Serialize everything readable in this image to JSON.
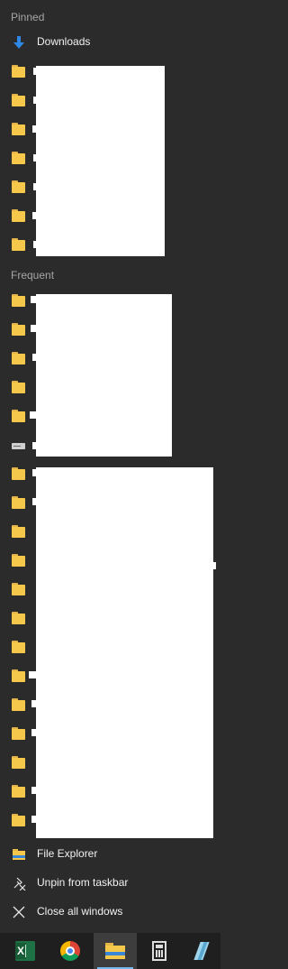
{
  "jumplist": {
    "pinned_header": "Pinned",
    "downloads_label": "Downloads",
    "frequent_header": "Frequent",
    "actions": [
      {
        "label": "File Explorer",
        "icon": "file-explorer-icon"
      },
      {
        "label": "Unpin from taskbar",
        "icon": "unpin-icon"
      },
      {
        "label": "Close all windows",
        "icon": "close-icon"
      }
    ]
  },
  "taskbar": {
    "apps": [
      {
        "name": "excel",
        "icon": "excel-icon",
        "active": false
      },
      {
        "name": "chrome",
        "icon": "chrome-icon",
        "active": false
      },
      {
        "name": "file-explorer",
        "icon": "file-explorer-icon",
        "active": true
      },
      {
        "name": "calculator",
        "icon": "calculator-icon",
        "active": false
      },
      {
        "name": "pen",
        "icon": "pen-icon",
        "active": false
      }
    ],
    "active_indicator_color": "#76b9ed"
  },
  "colors": {
    "background": "#2b2b2b",
    "header_text": "#a6a6a6",
    "item_text": "#f2f2f2",
    "folder": "#f5c84c",
    "download_arrow": "#2f88e6",
    "redaction": "#ffffff"
  }
}
